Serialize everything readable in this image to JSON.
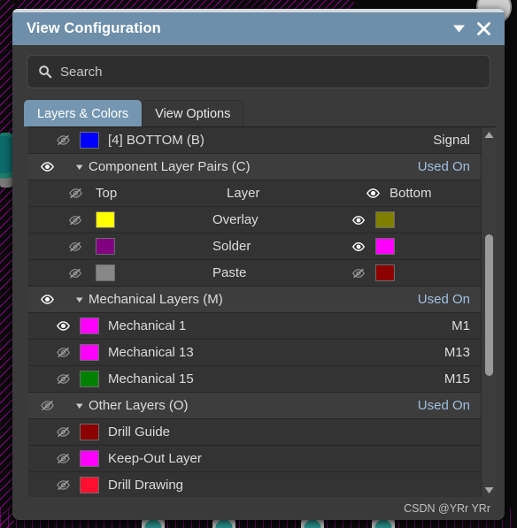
{
  "window": {
    "title": "View Configuration",
    "collapse_icon": "chevron-down-icon",
    "close_icon": "close-icon"
  },
  "search": {
    "placeholder": "Search",
    "value": "",
    "icon": "search-icon"
  },
  "tabs": [
    {
      "label": "Layers & Colors",
      "active": true
    },
    {
      "label": "View Options",
      "active": false
    }
  ],
  "list": {
    "signal_row": {
      "visibility": "hidden",
      "eye_icon": "eye-off-icon",
      "color": "#0000FF",
      "label": "[4] BOTTOM (B)",
      "right": "Signal"
    },
    "component_group": {
      "visibility": "visible",
      "eye_icon": "eye-on-icon",
      "caret_icon": "caret-down-icon",
      "label": "Component Layer Pairs (C)",
      "right": "Used On"
    },
    "pair_header": {
      "top_eye_icon": "eye-off-icon",
      "top_label": "Top",
      "middle_label": "Layer",
      "bottom_eye_icon": "eye-on-icon",
      "bottom_label": "Bottom"
    },
    "pairs": [
      {
        "top_eye_icon": "eye-off-icon",
        "top_color": "#FFFF00",
        "name": "Overlay",
        "bottom_eye_icon": "eye-on-icon",
        "bottom_color": "#808000"
      },
      {
        "top_eye_icon": "eye-off-icon",
        "top_color": "#800080",
        "name": "Solder",
        "bottom_eye_icon": "eye-on-icon",
        "bottom_color": "#FF00FF"
      },
      {
        "top_eye_icon": "eye-off-icon",
        "top_color": "#878787",
        "name": "Paste",
        "bottom_eye_icon": "eye-off-icon",
        "bottom_color": "#8B0000"
      }
    ],
    "mechanical_group": {
      "visibility": "visible",
      "eye_icon": "eye-on-icon",
      "caret_icon": "caret-down-icon",
      "label": "Mechanical Layers (M)",
      "right": "Used On"
    },
    "mechanical_layers": [
      {
        "eye_icon": "eye-on-icon",
        "color": "#FF00FF",
        "label": "Mechanical 1",
        "right": "M1"
      },
      {
        "eye_icon": "eye-off-icon",
        "color": "#FF00FF",
        "label": "Mechanical 13",
        "right": "M13"
      },
      {
        "eye_icon": "eye-off-icon",
        "color": "#008000",
        "label": "Mechanical 15",
        "right": "M15"
      }
    ],
    "other_group": {
      "visibility": "hidden",
      "eye_icon": "eye-off-icon",
      "caret_icon": "caret-down-icon",
      "label": "Other Layers (O)",
      "right": "Used On"
    },
    "other_layers": [
      {
        "eye_icon": "eye-off-icon",
        "color": "#8B0000",
        "label": "Drill Guide",
        "right": ""
      },
      {
        "eye_icon": "eye-off-icon",
        "color": "#FF00FF",
        "label": "Keep-Out Layer",
        "right": ""
      },
      {
        "eye_icon": "eye-off-icon",
        "color": "#FF1030",
        "label": "Drill Drawing",
        "right": ""
      }
    ]
  },
  "scrollbar": {
    "up_icon": "triangle-up-icon",
    "down_icon": "triangle-down-icon"
  },
  "footer": {
    "watermark": "CSDN @YRr YRr"
  },
  "colors": {
    "titlebar": "#6E8FAA",
    "active_tab": "#7496B1",
    "used_on_text": "#9FC0E0",
    "dialog_bg": "#3A3A3A",
    "row_bg": "#333333",
    "group_row_bg": "#3D3D3D"
  }
}
